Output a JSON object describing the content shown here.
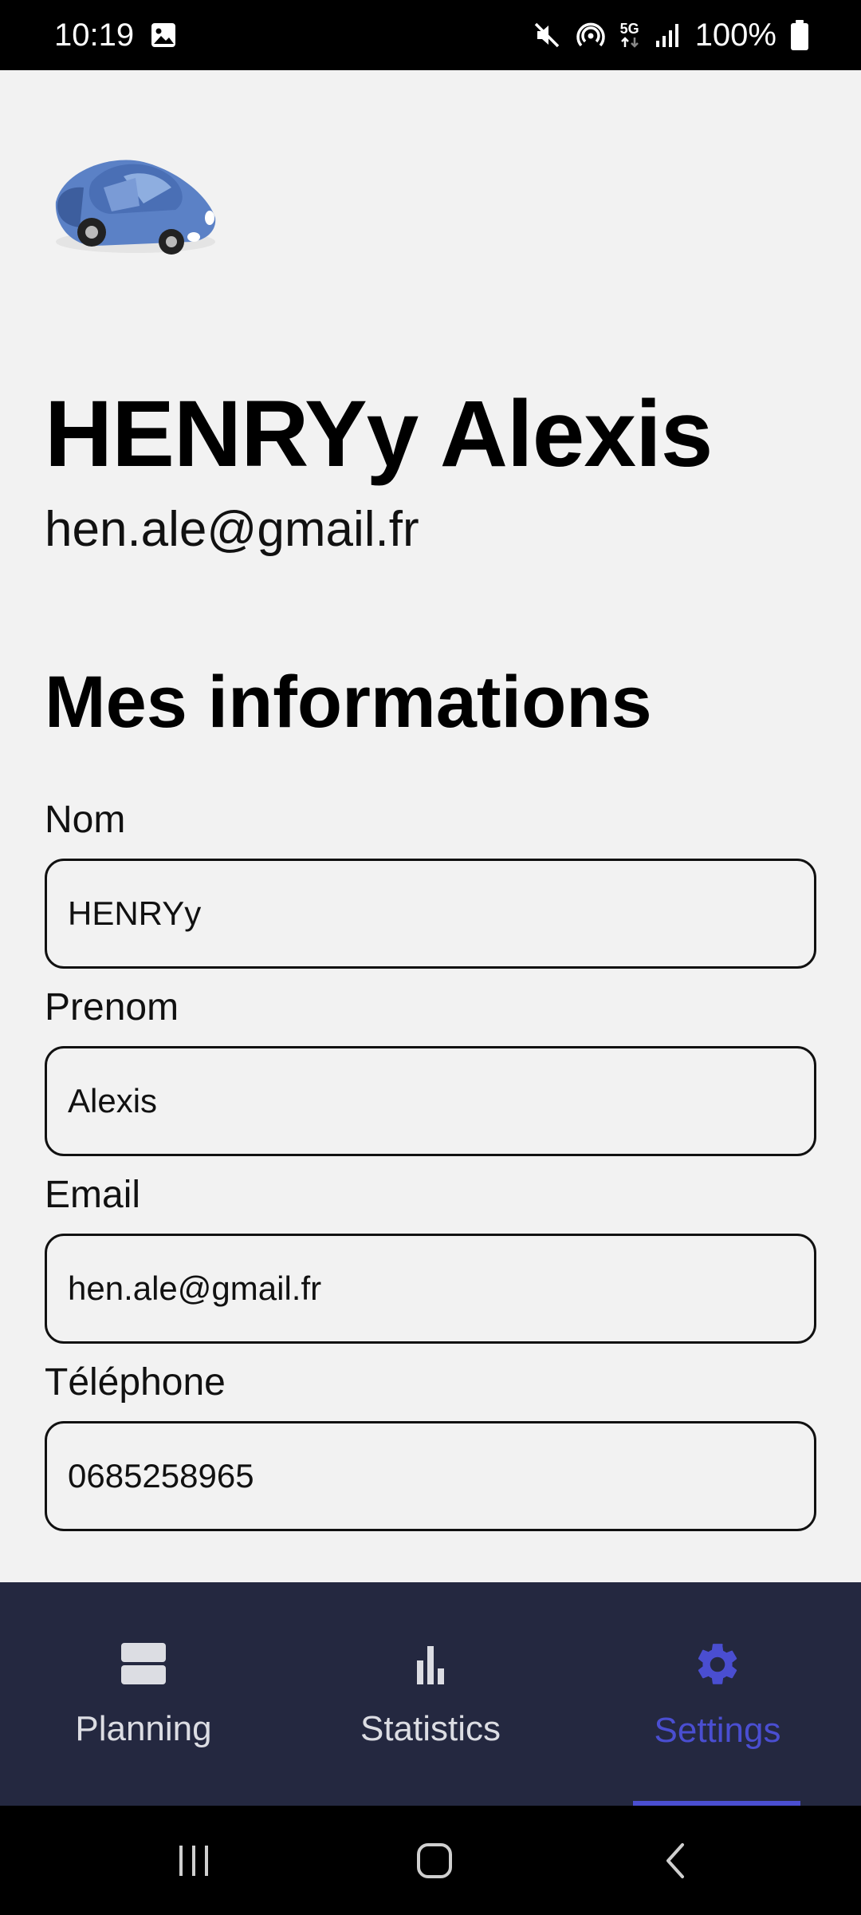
{
  "status_bar": {
    "time": "10:19",
    "battery_text": "100%",
    "network_label": "5G",
    "icons": [
      "image-icon",
      "mute-icon",
      "hotspot-icon",
      "5g-icon",
      "signal-icon",
      "battery-icon"
    ]
  },
  "profile": {
    "name": "HENRYy Alexis",
    "email": "hen.ale@gmail.fr",
    "logo_icon": "car-icon"
  },
  "section": {
    "title": "Mes informations"
  },
  "fields": {
    "nom": {
      "label": "Nom",
      "value": "HENRYy"
    },
    "prenom": {
      "label": "Prenom",
      "value": "Alexis"
    },
    "email": {
      "label": "Email",
      "value": "hen.ale@gmail.fr"
    },
    "telephone": {
      "label": "Téléphone",
      "value": "0685258965"
    }
  },
  "bottom_nav": {
    "items": [
      {
        "label": "Planning",
        "icon": "planning-icon"
      },
      {
        "label": "Statistics",
        "icon": "bar-chart-icon"
      },
      {
        "label": "Settings",
        "icon": "gear-icon",
        "active": true
      }
    ]
  },
  "system_nav": {
    "icons": [
      "recent-apps-icon",
      "home-icon",
      "back-icon"
    ]
  },
  "colors": {
    "background": "#f2f2f2",
    "nav_background": "#242840",
    "accent": "#4a4ed1",
    "nav_text": "#dcdde3"
  }
}
